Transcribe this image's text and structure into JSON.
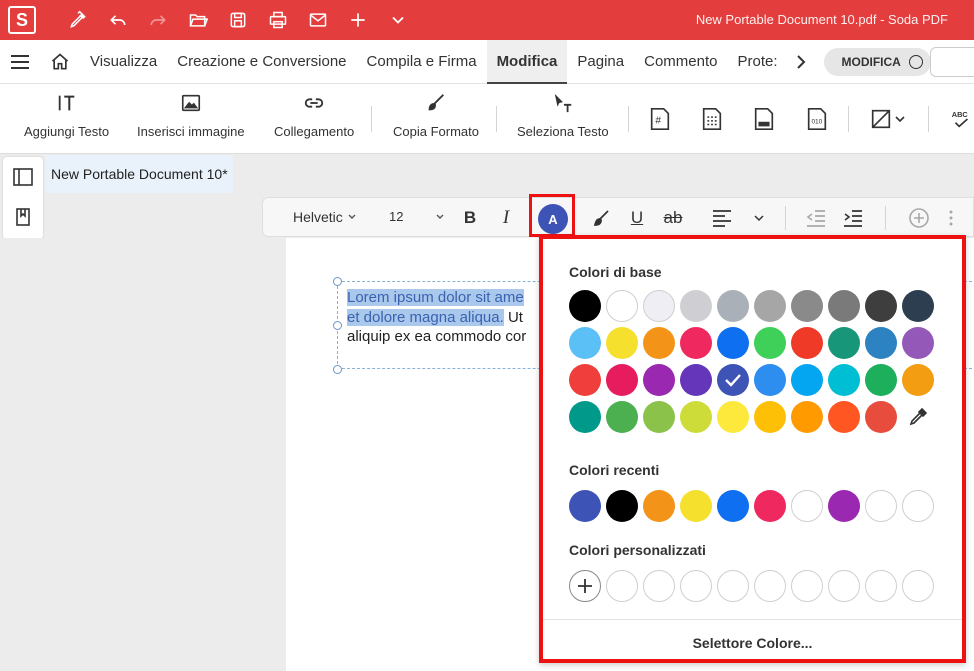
{
  "titlebar": {
    "logo_letter": "S",
    "document_title": "New Portable Document 10.pdf   -   Soda PDF",
    "quick_actions": [
      "pen-icon",
      "undo-icon",
      "redo-icon",
      "open-folder-icon",
      "save-icon",
      "print-icon",
      "mail-icon",
      "plus-icon",
      "chevron-down-icon"
    ]
  },
  "menu": {
    "items": [
      "Visualizza",
      "Creazione e Conversione",
      "Compila e Firma",
      "Modifica",
      "Pagina",
      "Commento",
      "Prote:"
    ],
    "active": "Modifica",
    "mode_label": "MODIFICA"
  },
  "ribbon": {
    "add_text": "Aggiungi Testo",
    "insert_image": "Inserisci immagine",
    "link": "Collegamento",
    "copy_format": "Copia Formato",
    "select_text": "Seleziona Testo"
  },
  "doc_tab": {
    "title": "New Portable Document 10*"
  },
  "format_toolbar": {
    "font": "Helvetic",
    "size": "12",
    "color_letter": "A",
    "active_color": "#3d53b5"
  },
  "document": {
    "line1_selected": "Lorem ipsum dolor sit ame",
    "line2_selected": "et dolore magna aliqua.",
    "line2_rest": " Ut",
    "line3": "aliquip ex ea commodo cor"
  },
  "color_picker": {
    "basic_title": "Colori di base",
    "recent_title": "Colori recenti",
    "custom_title": "Colori personalizzati",
    "footer_button": "Selettore Colore...",
    "selected_color": "#3d53b5",
    "basic_colors": [
      [
        "#000000",
        "#ffffff",
        "#eeeef4",
        "#cfcfd3",
        "#a9b0b8",
        "#a6a6a6",
        "#8a8a8a",
        "#7a7a7a",
        "#3e3e3e",
        "#2c3e50"
      ],
      [
        "#5bc0f5",
        "#f5e02e",
        "#f39418",
        "#f02860",
        "#0e6ff0",
        "#3ed058",
        "#f03a28",
        "#17967a",
        "#2d82c2",
        "#9358b8"
      ],
      [
        "#ef3e3c",
        "#e71c5e",
        "#9b28b0",
        "#6535ba",
        "#3d53b5",
        "#2d8ef0",
        "#04a6f2",
        "#00bed4",
        "#1eaf5d",
        "#f29d12"
      ],
      [
        "#00998a",
        "#4caf50",
        "#8bc34a",
        "#cddc39",
        "#fde93b",
        "#fec007",
        "#ff9a00",
        "#ff5622",
        "#e74c3c"
      ]
    ],
    "recent_colors": [
      "#3d53b5",
      "#000000",
      "#f39418",
      "#f5e02e",
      "#0e6ff0",
      "#f02860",
      "#ffffff",
      "#9b28b0",
      "#ffffff",
      "#ffffff"
    ],
    "custom_slots": 10
  }
}
